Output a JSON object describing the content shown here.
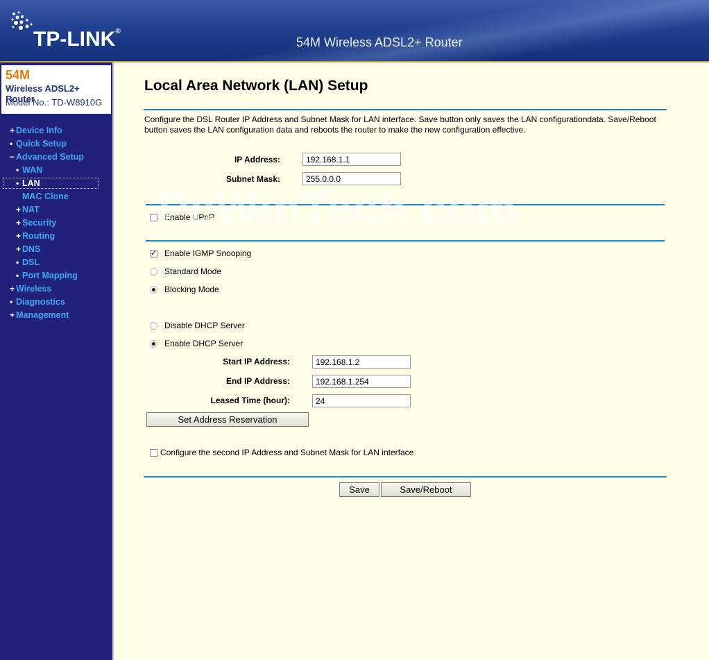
{
  "header": {
    "brand": "TP-LINK",
    "trademark": "®",
    "product_title": "54M Wireless ADSL2+ Router",
    "logo_icon": "tplink-dots-icon"
  },
  "model": {
    "speed": "54M",
    "name": "Wireless ADSL2+ Router",
    "model_label": "Model No.:",
    "model_number": "TD-W8910G"
  },
  "nav": {
    "items": [
      {
        "marker": "+",
        "label": "Device Info"
      },
      {
        "marker": "•",
        "label": "Quick Setup"
      },
      {
        "marker": "−",
        "label": "Advanced Setup"
      },
      {
        "marker": "•",
        "label": "WAN"
      },
      {
        "marker": "•",
        "label": "LAN"
      },
      {
        "marker": "",
        "label": "MAC Clone"
      },
      {
        "marker": "+",
        "label": "NAT"
      },
      {
        "marker": "+",
        "label": "Security"
      },
      {
        "marker": "+",
        "label": "Routing"
      },
      {
        "marker": "+",
        "label": "DNS"
      },
      {
        "marker": "•",
        "label": "DSL"
      },
      {
        "marker": "•",
        "label": "Port Mapping"
      },
      {
        "marker": "+",
        "label": "Wireless"
      },
      {
        "marker": "•",
        "label": "Diagnostics"
      },
      {
        "marker": "+",
        "label": "Management"
      }
    ],
    "active": "LAN"
  },
  "main": {
    "title": "Local Area Network (LAN) Setup",
    "description": "Configure the DSL Router IP Address and Subnet Mask for LAN interface.  Save button only saves the LAN configurationdata.  Save/Reboot button saves the LAN configuration data and reboots the router to make the new configuration effective.",
    "ip_address_label": "IP Address:",
    "ip_address_value": "192.168.1.1",
    "subnet_mask_label": "Subnet Mask:",
    "subnet_mask_value": "255.0.0.0",
    "upnp_label": "Enable UPnP",
    "upnp_checked": false,
    "igmp_label": "Enable IGMP Snooping",
    "igmp_checked": true,
    "standard_mode_label": "Standard Mode",
    "blocking_mode_label": "Blocking Mode",
    "blocking_mode_selected": true,
    "disable_dhcp_label": "Disable DHCP Server",
    "enable_dhcp_label": "Enable DHCP Server",
    "enable_dhcp_selected": true,
    "start_ip_label": "Start IP Address:",
    "start_ip_value": "192.168.1.2",
    "end_ip_label": "End IP Address:",
    "end_ip_value": "192.168.1.254",
    "lease_label": "Leased Time (hour):",
    "lease_value": "24",
    "reservation_button": "Set Address Reservation",
    "second_ip_label": "Configure the second IP Address and Subnet Mask for LAN interface",
    "second_ip_checked": false,
    "save_button": "Save",
    "save_reboot_button": "Save/Reboot"
  },
  "watermark": "PcWinTech.com",
  "colors": {
    "header_bg": "#21408f",
    "sidebar_bg": "#22217a",
    "nav_link": "#3fa8f0",
    "page_bg": "#fefde8",
    "divider": "#1d86c4",
    "model_accent": "#e07a10"
  }
}
